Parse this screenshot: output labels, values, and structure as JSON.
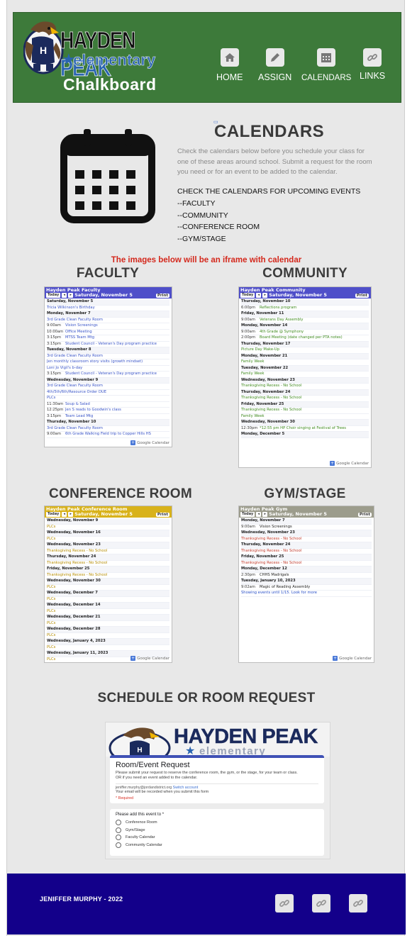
{
  "header": {
    "logo_title_1": "HAYDEN ",
    "logo_title_2": "PEAK",
    "logo_sub": "elementary",
    "site_name": "Chalkboard",
    "nav": [
      {
        "label": "HOME",
        "icon": "home-icon"
      },
      {
        "label": "ASSIGN",
        "icon": "pencil-icon"
      },
      {
        "label": "CALENDARS",
        "icon": "calendar-icon"
      },
      {
        "label": "LINKS",
        "icon": "link-icon"
      }
    ]
  },
  "calendars_intro": {
    "heading": "CALENDARS",
    "description": "Check the calendars below before you schedule your class for one of these areas around school. Submit a request for the room you need or for an event to be added to the calendar.",
    "check_title": "CHECK THE CALENDARS FOR UPCOMING EVENTS",
    "check_items": [
      "--FACULTY",
      "--COMMUNITY",
      "--CONFERENCE ROOM",
      "--GYM/STAGE"
    ],
    "iframe_note": "The images below will be an iframe with calendar"
  },
  "sections": {
    "faculty": "FACULTY",
    "community": "COMMUNITY",
    "conference": "CONFERENCE ROOM",
    "gym": "GYM/STAGE"
  },
  "gcal_common": {
    "today": "Today",
    "print": "Print",
    "google": "Google Calendar"
  },
  "calendars": {
    "faculty": {
      "title": "Hayden Peak Faculty",
      "date": "Saturday, November 5",
      "color": "#4f4fc9",
      "rows": [
        {
          "day": "Saturday, November 5"
        },
        {
          "time": "",
          "text": "Tricia Wilkinson's Birthday",
          "color": "#3a55c8"
        },
        {
          "day": "Monday, November 7"
        },
        {
          "time": "",
          "text": "3rd Grade Clean Faculty Room",
          "color": "#3a55c8"
        },
        {
          "time": "9:00am",
          "text": "Vision Screenings",
          "color": "#3a55c8"
        },
        {
          "time": "10:00am",
          "text": "Office Meeting",
          "color": "#3a55c8"
        },
        {
          "time": "3:15pm",
          "text": "MTSS Team Mtg",
          "color": "#3a55c8"
        },
        {
          "time": "3:15pm",
          "text": "Student Council - Veteran's Day program practice",
          "color": "#3a55c8"
        },
        {
          "day": "Tuesday, November 8"
        },
        {
          "time": "",
          "text": "3rd Grade Clean Faculty Room",
          "color": "#3a55c8"
        },
        {
          "time": "",
          "text": "Jen monthly classroom story visits (growth mindset)",
          "color": "#3a55c8"
        },
        {
          "time": "",
          "text": "Loni Jo Vigil's b-day",
          "color": "#3a55c8"
        },
        {
          "time": "3:15pm",
          "text": "Student Council - Veteran's Day program practice",
          "color": "#3a55c8"
        },
        {
          "day": "Wednesday, November 9"
        },
        {
          "time": "",
          "text": "3rd Grade Clean Faculty Room",
          "color": "#3a55c8"
        },
        {
          "time": "",
          "text": "4th/5th/6th/Resource Order DUE",
          "color": "#3a55c8"
        },
        {
          "time": "",
          "text": "PLCs",
          "color": "#3a55c8"
        },
        {
          "time": "11:30am",
          "text": "Soup & Salad",
          "color": "#3a55c8"
        },
        {
          "time": "12:25pm",
          "text": "Jen S reads to Goodwin's class",
          "color": "#3a55c8"
        },
        {
          "time": "3:15pm",
          "text": "Team Lead Mtg",
          "color": "#3a55c8"
        },
        {
          "day": "Thursday, November 10"
        },
        {
          "time": "",
          "text": "3rd Grade Clean Faculty Room",
          "color": "#3a55c8"
        },
        {
          "time": "9:00am",
          "text": "6th Grade Walking Field trip to Copper Hills HS",
          "color": "#3a55c8"
        }
      ]
    },
    "community": {
      "title": "Hayden Peak Community",
      "date": "Saturday, November 5",
      "color": "#4f4fc9",
      "rows": [
        {
          "day": "Thursday, November 10"
        },
        {
          "time": "6:00pm",
          "text": "Reflections program",
          "color": "#3f8a1f"
        },
        {
          "day": "Friday, November 11"
        },
        {
          "time": "9:00am",
          "text": "Veterans Day Assembly",
          "color": "#3f8a1f"
        },
        {
          "day": "Monday, November 14"
        },
        {
          "time": "9:00am",
          "text": "4th Grade @ Symphony",
          "color": "#3f8a1f"
        },
        {
          "time": "2:00pm",
          "text": "Board Meeting (date changed per PTA notes)",
          "color": "#3f8a1f"
        },
        {
          "day": "Thursday, November 17"
        },
        {
          "time": "",
          "text": "Picture Day Make-Up",
          "color": "#3f8a1f"
        },
        {
          "day": "Monday, November 21"
        },
        {
          "time": "",
          "text": "Family Week",
          "color": "#3f8a1f"
        },
        {
          "day": "Tuesday, November 22"
        },
        {
          "time": "",
          "text": "Family Week",
          "color": "#3f8a1f"
        },
        {
          "day": "Wednesday, November 23"
        },
        {
          "time": "",
          "text": "Thanksgiving Recess - No School",
          "color": "#3f8a1f"
        },
        {
          "day": "Thursday, November 24"
        },
        {
          "time": "",
          "text": "Thanksgiving Recess - No School",
          "color": "#3f8a1f"
        },
        {
          "day": "Friday, November 25"
        },
        {
          "time": "",
          "text": "Thanksgiving Recess - No School",
          "color": "#3f8a1f"
        },
        {
          "time": "",
          "text": "Family Week",
          "color": "#3f8a1f"
        },
        {
          "day": "Wednesday, November 30"
        },
        {
          "time": "12:30pm",
          "text": "*12:55 pm HP Choir singing at Festival of Trees",
          "color": "#3f8a1f"
        },
        {
          "day": "Monday, December 5"
        }
      ]
    },
    "conference": {
      "title": "Hayden Peak Conference Room",
      "date": "Saturday, November 5",
      "color": "#d8b21a",
      "rows": [
        {
          "day": "Wednesday, November 9"
        },
        {
          "time": "",
          "text": "PLCs",
          "color": "#b58c00"
        },
        {
          "day": "Wednesday, November 16"
        },
        {
          "time": "",
          "text": "PLCs",
          "color": "#b58c00"
        },
        {
          "day": "Wednesday, November 23"
        },
        {
          "time": "",
          "text": "Thanksgiving Recess - No School",
          "color": "#b58c00"
        },
        {
          "day": "Thursday, November 24"
        },
        {
          "time": "",
          "text": "Thanksgiving Recess - No School",
          "color": "#b58c00"
        },
        {
          "day": "Friday, November 25"
        },
        {
          "time": "",
          "text": "Thanksgiving Recess - No School",
          "color": "#b58c00"
        },
        {
          "day": "Wednesday, November 30"
        },
        {
          "time": "",
          "text": "PLCs",
          "color": "#b58c00"
        },
        {
          "day": "Wednesday, December 7"
        },
        {
          "time": "",
          "text": "PLCs",
          "color": "#b58c00"
        },
        {
          "day": "Wednesday, December 14"
        },
        {
          "time": "",
          "text": "PLCs",
          "color": "#b58c00"
        },
        {
          "day": "Wednesday, December 21"
        },
        {
          "time": "",
          "text": "PLCs",
          "color": "#b58c00"
        },
        {
          "day": "Wednesday, December 28"
        },
        {
          "time": "",
          "text": "PLCs",
          "color": "#b58c00"
        },
        {
          "day": "Wednesday, January 4, 2023"
        },
        {
          "time": "",
          "text": "PLCs",
          "color": "#b58c00"
        },
        {
          "day": "Wednesday, January 11, 2023"
        },
        {
          "time": "",
          "text": "PLCs",
          "color": "#b58c00"
        }
      ]
    },
    "gym": {
      "title": "Hayden Peak Gym",
      "date": "Saturday, November 5",
      "color": "#9c9c8c",
      "rows": [
        {
          "day": "Monday, November 7"
        },
        {
          "time": "9:00am",
          "text": "Vision Screenings",
          "color": "#222"
        },
        {
          "day": "Wednesday, November 23"
        },
        {
          "time": "",
          "text": "Thanksgiving Recess - No School",
          "color": "#c0392b"
        },
        {
          "day": "Thursday, November 24"
        },
        {
          "time": "",
          "text": "Thanksgiving Recess - No School",
          "color": "#c0392b"
        },
        {
          "day": "Friday, November 25"
        },
        {
          "time": "",
          "text": "Thanksgiving Recess - No School",
          "color": "#c0392b"
        },
        {
          "day": "Monday, December 12"
        },
        {
          "time": "2:30pm",
          "text": "CHHS Madrigals",
          "color": "#222"
        },
        {
          "day": "Tuesday, January 10, 2023"
        },
        {
          "time": "9:02am",
          "text": "Magic of Reading Assembly",
          "color": "#222"
        },
        {
          "time": "",
          "text": "Showing events until 1/15. Look for more",
          "color": "#2a50c8"
        }
      ]
    }
  },
  "schedule": {
    "heading": "SCHEDULE OR ROOM REQUEST",
    "form_logo_text": "HAYDEN PEAK",
    "form_logo_sub": "elementary",
    "form_title": "Room/Event Request",
    "form_desc": "Please submit your request to reserve the conference room, the gym, or the stage, for your team or class.",
    "form_desc2": "OR if you need an event added to the calendar.",
    "account": "jeniffer.murphy@jordandistrict.org",
    "switch": "Switch account",
    "recorded": "Your email will be recorded when you submit this form",
    "required": "* Required",
    "question": "Please add this event to *",
    "options": [
      "Conference Room",
      "Gym/Stage",
      "Faculty Calendar",
      "Community Calendar"
    ]
  },
  "footer": {
    "text": "JENIFFER MURPHY - 2022",
    "links": [
      "link-icon",
      "link-icon",
      "link-icon"
    ]
  }
}
